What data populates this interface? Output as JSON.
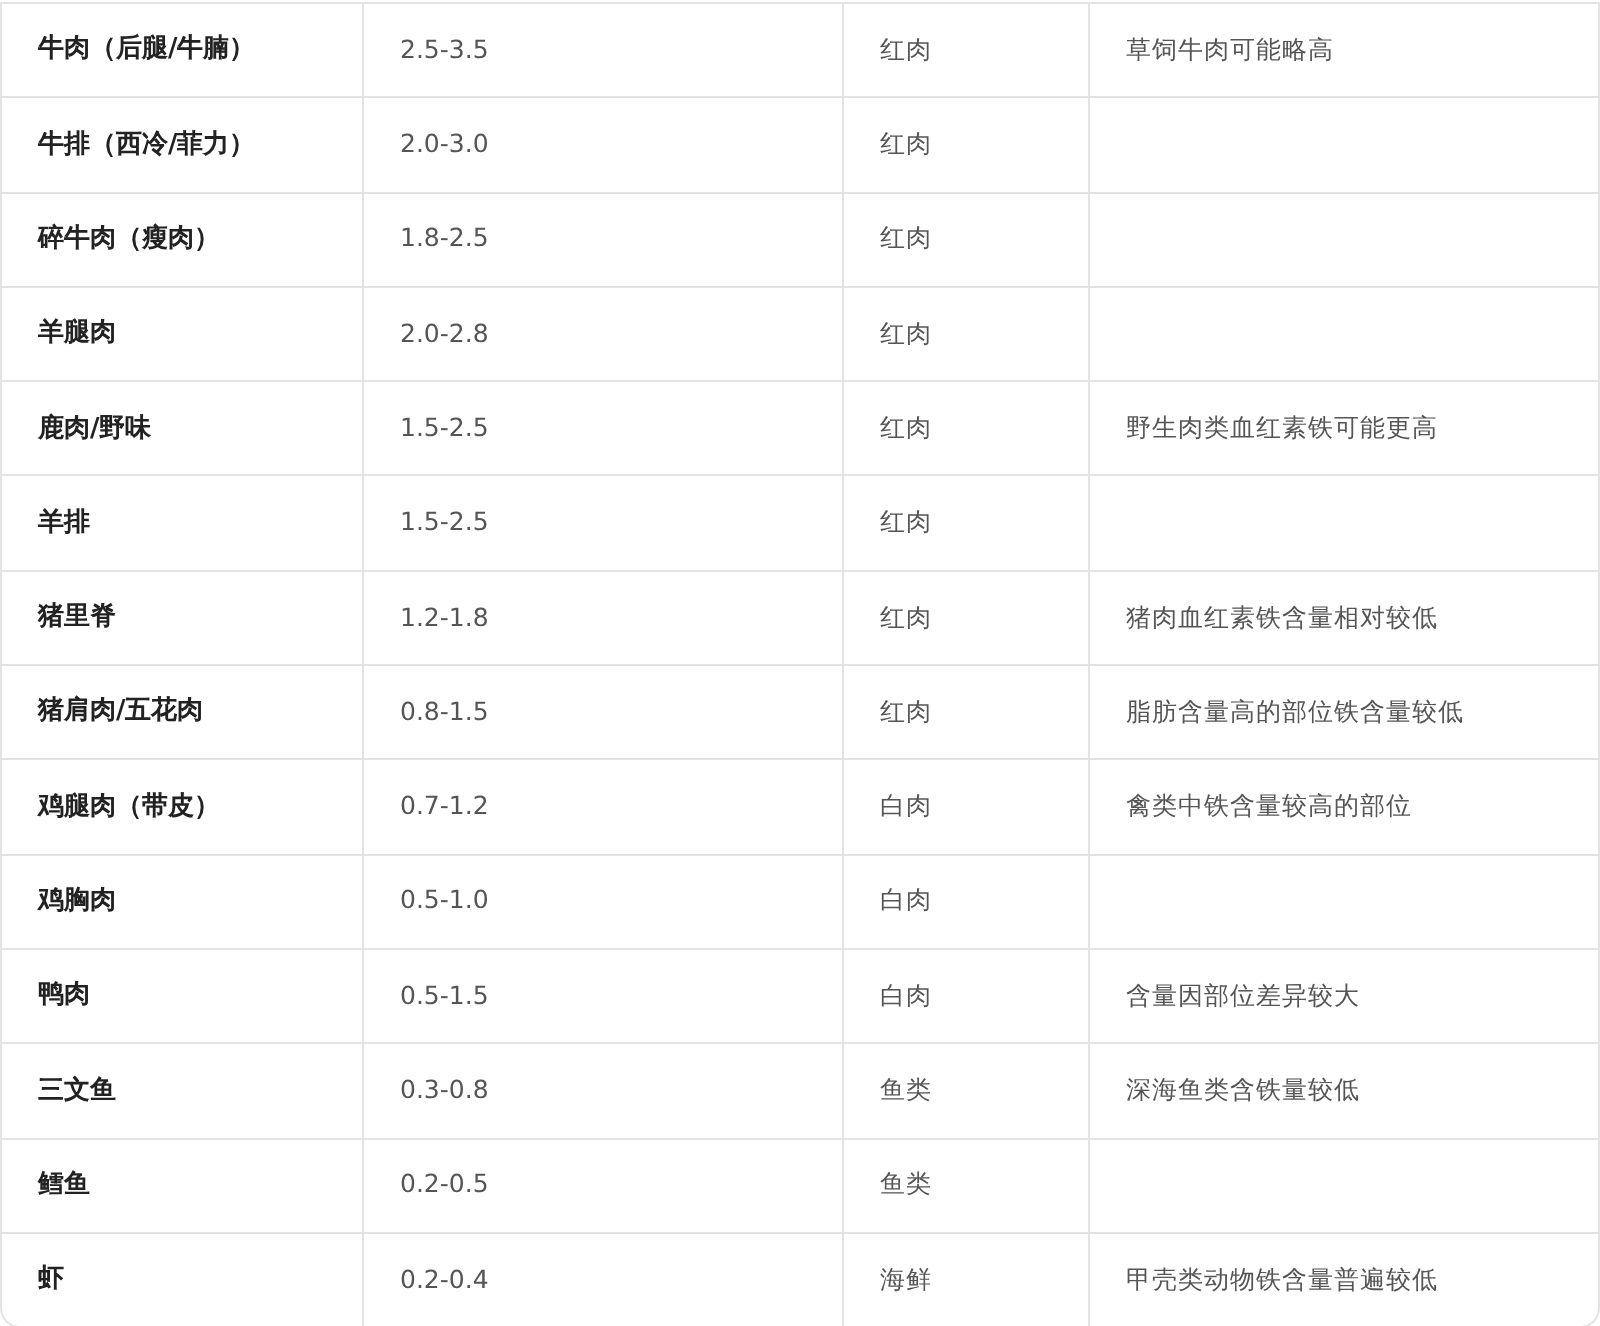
{
  "table": {
    "rows": [
      {
        "column_1": "牛肉（后腿/牛腩）",
        "column_2": "2.5-3.5",
        "column_3": "红肉",
        "column_4": "草饲牛肉可能略高"
      },
      {
        "column_1": "牛排（西冷/菲力）",
        "column_2": "2.0-3.0",
        "column_3": "红肉"
      },
      {
        "column_1": "碎牛肉（瘦肉）",
        "column_2": "1.8-2.5",
        "column_3": "红肉"
      },
      {
        "column_1": "羊腿肉",
        "column_2": "2.0-2.8",
        "column_3": "红肉"
      },
      {
        "column_1": "鹿肉/野味",
        "column_2": "1.5-2.5",
        "column_3": "红肉",
        "column_4": "野生肉类血红素铁可能更高"
      },
      {
        "column_1": "羊排",
        "column_2": "1.5-2.5",
        "column_3": "红肉"
      },
      {
        "column_1": "猪里脊",
        "column_2": "1.2-1.8",
        "column_3": "红肉",
        "column_4": "猪肉血红素铁含量相对较低"
      },
      {
        "column_1": "猪肩肉/五花肉",
        "column_2": "0.8-1.5",
        "column_3": "红肉",
        "column_4": "脂肪含量高的部位铁含量较低"
      },
      {
        "column_1": "鸡腿肉（带皮）",
        "column_2": "0.7-1.2",
        "column_3": "白肉",
        "column_4": "禽类中铁含量较高的部位"
      },
      {
        "column_1": "鸡胸肉",
        "column_2": "0.5-1.0",
        "column_3": "白肉"
      },
      {
        "column_1": "鸭肉",
        "column_2": "0.5-1.5",
        "column_3": "白肉",
        "column_4": "含量因部位差异较大"
      },
      {
        "column_1": "三文鱼",
        "column_2": "0.3-0.8",
        "column_3": "鱼类",
        "column_4": "深海鱼类含铁量较低"
      },
      {
        "column_1": "鳕鱼",
        "column_2": "0.2-0.5",
        "column_3": "鱼类"
      },
      {
        "column_1": "虾",
        "column_2": "0.2-0.4",
        "column_3": "海鲜",
        "column_4": "甲壳类动物铁含量普遍较低"
      }
    ]
  }
}
